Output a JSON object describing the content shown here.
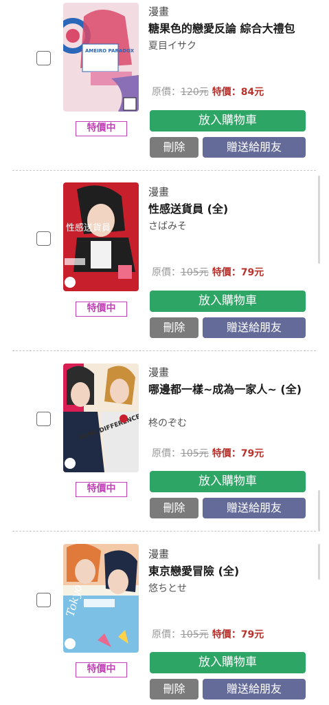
{
  "items": [
    {
      "category": "漫畫",
      "title": "糖果色的戀愛反論 綜合大禮包",
      "author": "夏目イサク",
      "original_price_label": "原價：",
      "original_price": "120元",
      "sale_price_label": "特價：",
      "sale_price": "84元",
      "badge": "特價中",
      "add_to_cart": "放入購物車",
      "delete": "刪除",
      "gift": "贈送給朋友",
      "cover_text": "AMEIRO PARADOX",
      "cover_colors": [
        "#d94a6b",
        "#2a67b8",
        "#f3dbe2"
      ]
    },
    {
      "category": "漫畫",
      "title": "性感送貨員 (全)",
      "author": "さばみそ",
      "original_price_label": "原價：",
      "original_price": "105元",
      "sale_price_label": "特價：",
      "sale_price": "79元",
      "badge": "特價中",
      "add_to_cart": "放入購物車",
      "delete": "刪除",
      "gift": "贈送給朋友",
      "cover_text": "性感送貨員",
      "cover_colors": [
        "#c71f2c",
        "#1f1f1f",
        "#f2f2f2"
      ]
    },
    {
      "category": "漫畫",
      "title": "哪邊都一樣~成為一家人~ (全)",
      "author": "柊のぞむ",
      "original_price_label": "原價：",
      "original_price": "105元",
      "sale_price_label": "特價：",
      "sale_price": "79元",
      "badge": "特價中",
      "add_to_cart": "放入購物車",
      "delete": "刪除",
      "gift": "贈送給朋友",
      "cover_text": "SAME DIFFERENCE",
      "cover_colors": [
        "#d91e54",
        "#2c2c2c",
        "#f5e9d9"
      ]
    },
    {
      "category": "漫畫",
      "title": "東京戀愛冒險 (全)",
      "author": "悠ちとせ",
      "original_price_label": "原價：",
      "original_price": "105元",
      "sale_price_label": "特價：",
      "sale_price": "79元",
      "badge": "特價中",
      "add_to_cart": "放入購物車",
      "delete": "刪除",
      "gift": "贈送給朋友",
      "cover_text": "Tokyo",
      "cover_colors": [
        "#7cc0e6",
        "#e07a3a",
        "#f7f2e6"
      ]
    }
  ]
}
